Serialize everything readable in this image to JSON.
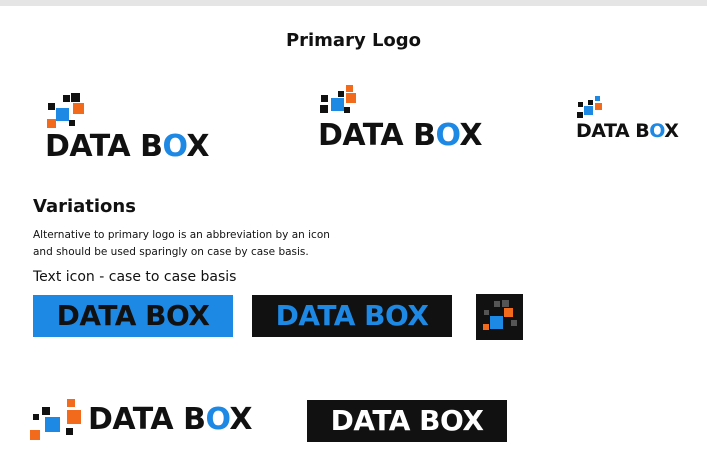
{
  "header": {
    "title": "Primary Logo"
  },
  "logos": {
    "wordmark_part1": "DATA B",
    "wordmark_o": "O",
    "wordmark_part2": "X",
    "wordmark_full": "DATA BOX"
  },
  "variations": {
    "heading": "Variations",
    "description_line1": "Alternative to primary logo is an abbreviation by an icon",
    "description_line2": "and should be used sparingly on case by case basis.",
    "text_icon_label": "Text icon - case to case basis"
  },
  "colors": {
    "blue": "#1e88e5",
    "orange": "#f26b1d",
    "black": "#111111",
    "white": "#ffffff"
  }
}
